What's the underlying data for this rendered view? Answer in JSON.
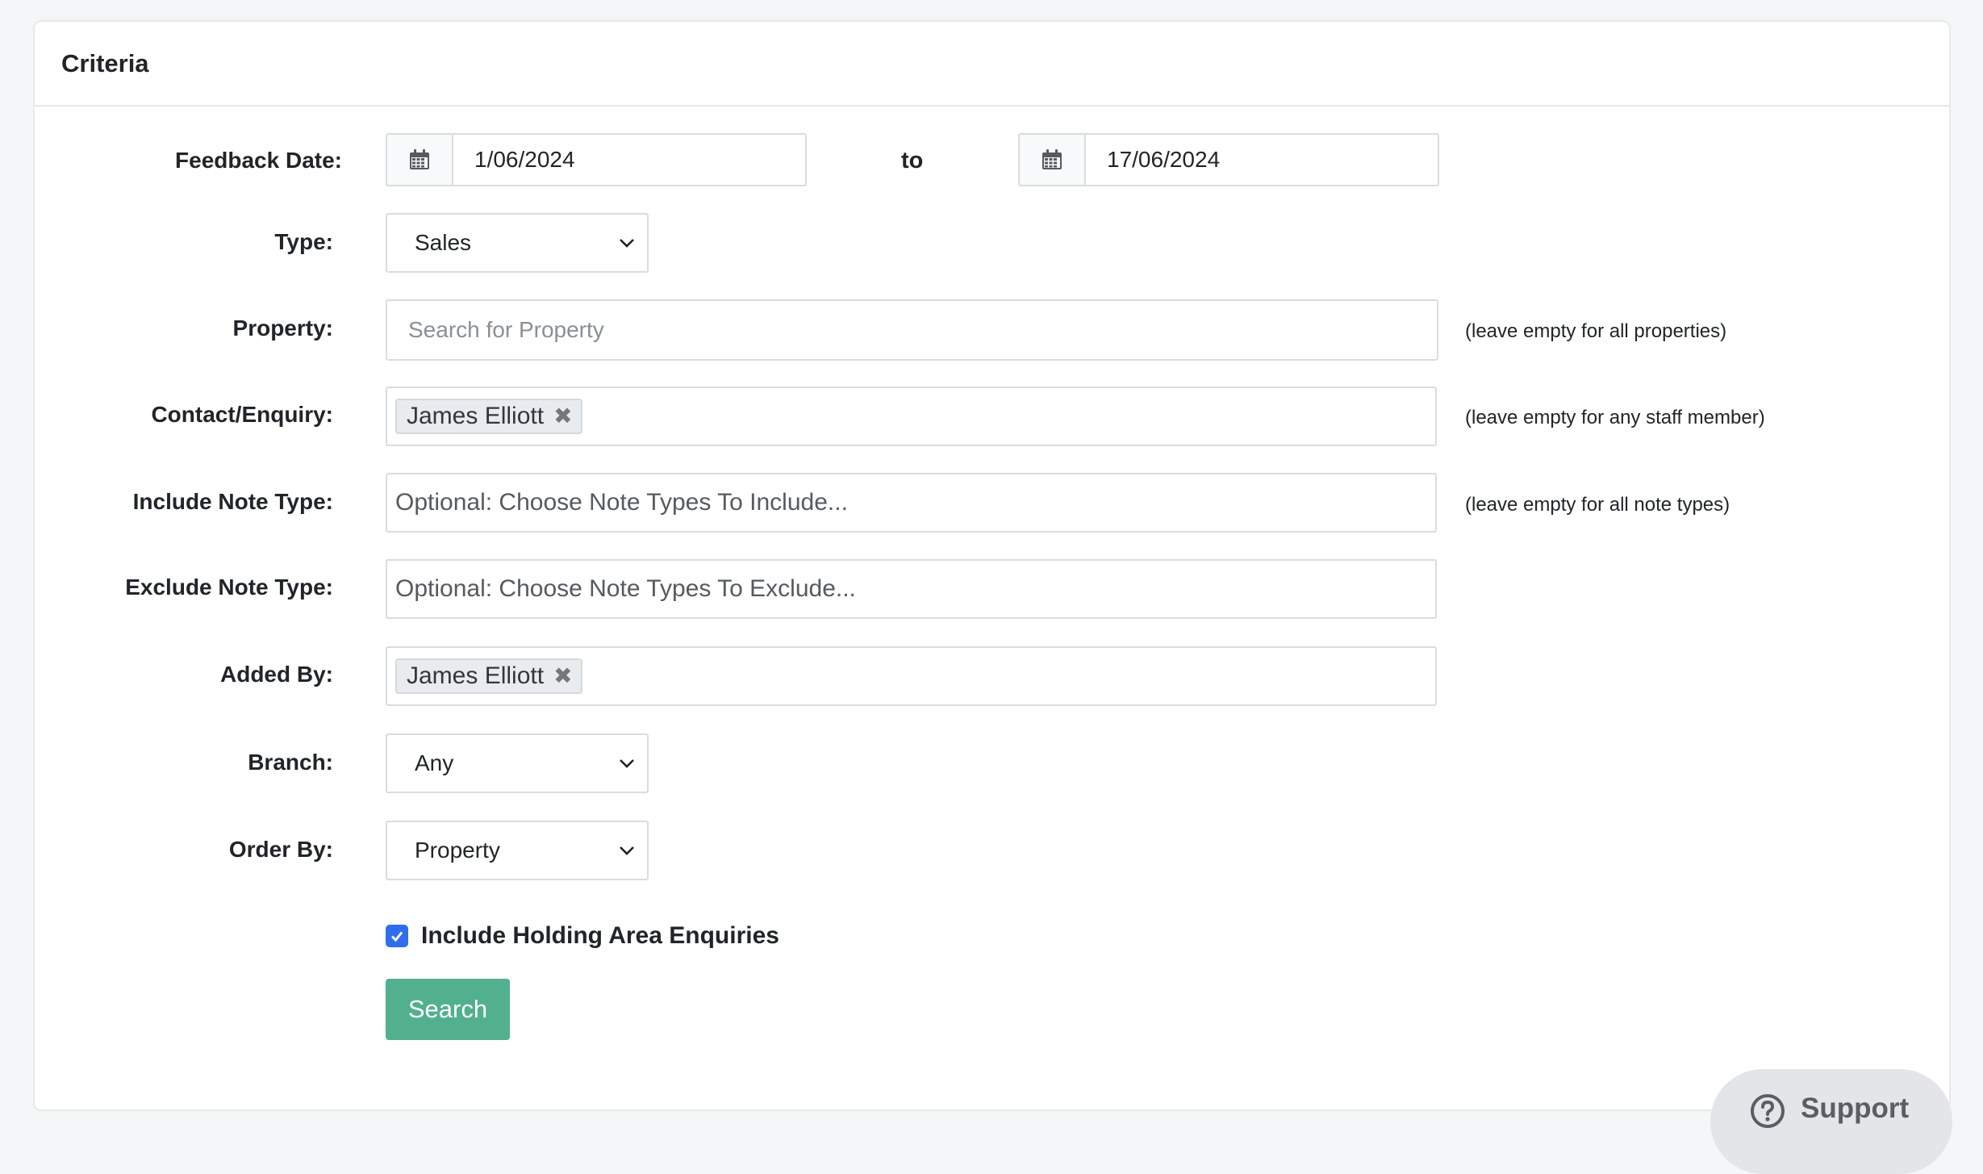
{
  "card": {
    "title": "Criteria"
  },
  "feedback_date": {
    "label": "Feedback Date:",
    "from_value": "1/06/2024",
    "to_label": "to",
    "to_value": "17/06/2024"
  },
  "type": {
    "label": "Type:",
    "selected": "Sales"
  },
  "property": {
    "label": "Property:",
    "placeholder": "Search for Property",
    "hint": "(leave empty for all properties)"
  },
  "contact": {
    "label": "Contact/Enquiry:",
    "tag": "James Elliott",
    "hint": "(leave empty for any staff member)"
  },
  "include_note": {
    "label": "Include Note Type:",
    "placeholder": "Optional: Choose Note Types To Include...",
    "hint": "(leave empty for all note types)"
  },
  "exclude_note": {
    "label": "Exclude Note Type:",
    "placeholder": "Optional: Choose Note Types To Exclude..."
  },
  "added_by": {
    "label": "Added By:",
    "tag": "James Elliott"
  },
  "branch": {
    "label": "Branch:",
    "selected": "Any"
  },
  "order_by": {
    "label": "Order By:",
    "selected": "Property"
  },
  "holding_area": {
    "label": "Include Holding Area Enquiries",
    "checked": true
  },
  "search_button": {
    "label": "Search"
  },
  "support_button": {
    "label": "Support"
  },
  "colors": {
    "primary": "#52b08e",
    "checkbox": "#2f6fed",
    "border": "#d9dce0"
  }
}
